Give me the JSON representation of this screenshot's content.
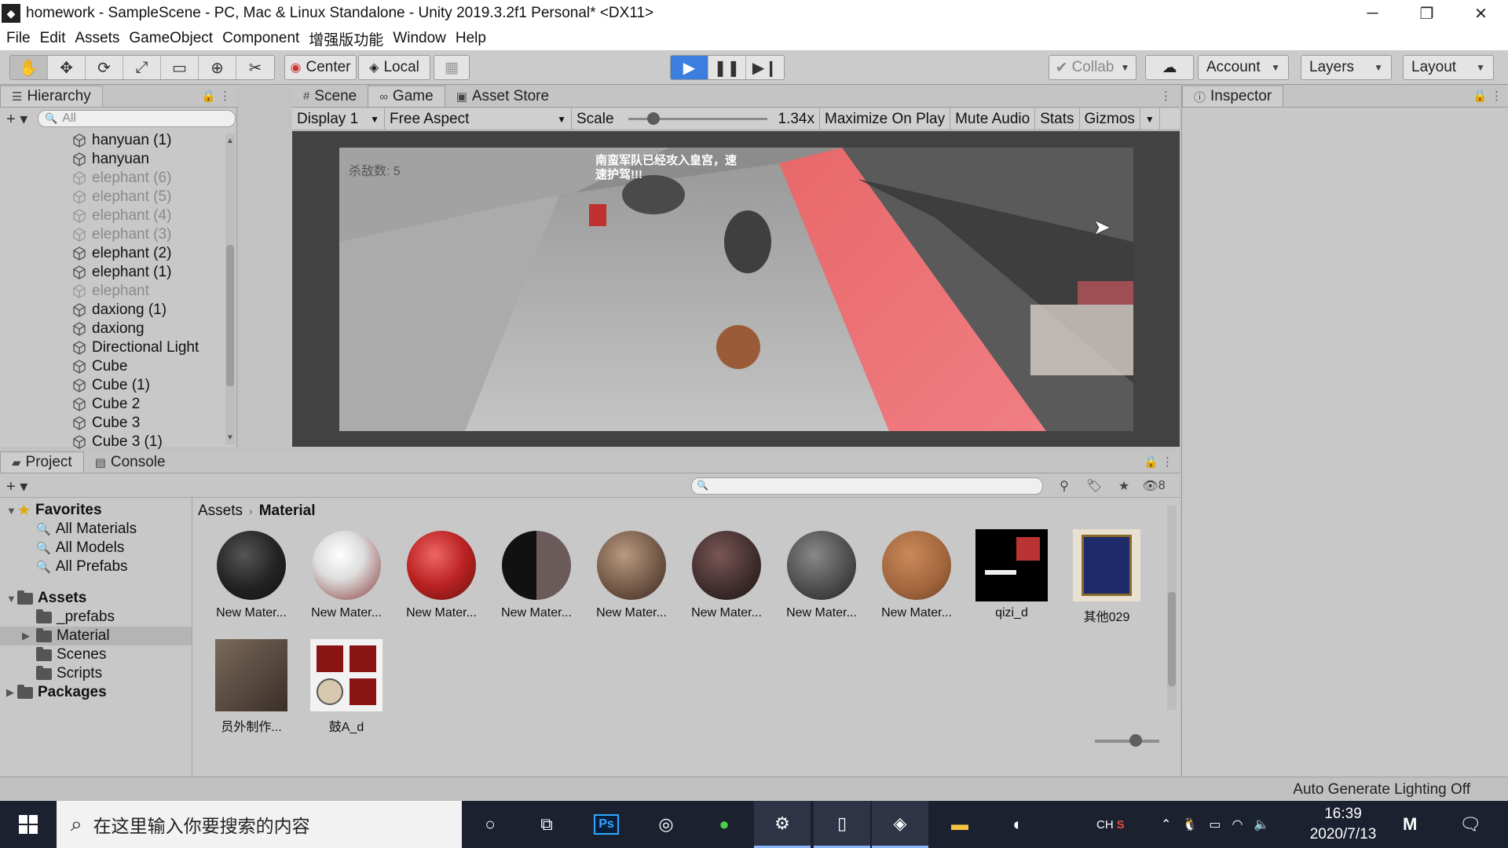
{
  "window": {
    "title": "homework - SampleScene - PC, Mac & Linux Standalone - Unity 2019.3.2f1 Personal* <DX11>",
    "minimize": "─",
    "restore": "❐",
    "close": "✕"
  },
  "menu": [
    "File",
    "Edit",
    "Assets",
    "GameObject",
    "Component",
    "增强版功能",
    "Window",
    "Help"
  ],
  "toolbar": {
    "pivot_label": "Center",
    "space_label": "Local",
    "collab_label": "Collab",
    "account_label": "Account",
    "layers_label": "Layers",
    "layout_label": "Layout"
  },
  "hierarchy": {
    "tab": "Hierarchy",
    "search_placeholder": "All",
    "items": [
      {
        "label": "hanyuan (1)",
        "dim": false
      },
      {
        "label": "hanyuan",
        "dim": false
      },
      {
        "label": "elephant (6)",
        "dim": true
      },
      {
        "label": "elephant (5)",
        "dim": true
      },
      {
        "label": "elephant (4)",
        "dim": true
      },
      {
        "label": "elephant (3)",
        "dim": true
      },
      {
        "label": "elephant (2)",
        "dim": false
      },
      {
        "label": "elephant (1)",
        "dim": false
      },
      {
        "label": "elephant",
        "dim": true
      },
      {
        "label": "daxiong (1)",
        "dim": false
      },
      {
        "label": "daxiong",
        "dim": false
      },
      {
        "label": "Directional Light",
        "dim": false
      },
      {
        "label": "Cube",
        "dim": false
      },
      {
        "label": "Cube (1)",
        "dim": false
      },
      {
        "label": "Cube 2",
        "dim": false
      },
      {
        "label": "Cube 3",
        "dim": false
      },
      {
        "label": "Cube 3 (1)",
        "dim": false
      }
    ]
  },
  "center_tabs": {
    "scene": "Scene",
    "game": "Game",
    "asset_store": "Asset Store"
  },
  "game_toolbar": {
    "display": "Display 1",
    "aspect": "Free Aspect",
    "scale_label": "Scale",
    "scale_value": "1.34x",
    "maximize": "Maximize On Play",
    "mute": "Mute Audio",
    "stats": "Stats",
    "gizmos": "Gizmos"
  },
  "game_view": {
    "kill_count": "杀敌数: 5",
    "alert": "南蛮军队已经攻入皇宫，速速护驾!!!"
  },
  "inspector": {
    "tab": "Inspector"
  },
  "project": {
    "tab_project": "Project",
    "tab_console": "Console",
    "hidden_count": "8",
    "favorites_label": "Favorites",
    "favorites": [
      "All Materials",
      "All Models",
      "All Prefabs"
    ],
    "assets_label": "Assets",
    "folders": [
      "_prefabs",
      "Material",
      "Scenes",
      "Scripts"
    ],
    "packages_label": "Packages",
    "breadcrumb": {
      "root": "Assets",
      "current": "Material"
    },
    "assets": [
      {
        "label": "New Mater...",
        "thumb": "dark-sphere"
      },
      {
        "label": "New Mater...",
        "thumb": "white-red-sphere"
      },
      {
        "label": "New Mater...",
        "thumb": "red-white-sphere"
      },
      {
        "label": "New Mater...",
        "thumb": "black-split-sphere"
      },
      {
        "label": "New Mater...",
        "thumb": "brown-sphere"
      },
      {
        "label": "New Mater...",
        "thumb": "dark-red-sphere"
      },
      {
        "label": "New Mater...",
        "thumb": "gray-tile-sphere"
      },
      {
        "label": "New Mater...",
        "thumb": "wood-sphere"
      },
      {
        "label": "qizi_d",
        "thumb": "flag-texture"
      },
      {
        "label": "其他029",
        "thumb": "plaque-texture"
      },
      {
        "label": "员外制作...",
        "thumb": "character-texture"
      },
      {
        "label": "鼓A_d",
        "thumb": "drum-texture"
      }
    ]
  },
  "status": {
    "lighting": "Auto Generate Lighting Off"
  },
  "taskbar": {
    "search_placeholder": "在这里输入你要搜索的内容",
    "ime": "CH",
    "time": "16:39",
    "date": "2020/7/13"
  },
  "colors": {
    "accent": "#3c7ee0",
    "panel_bg": "#c8c8c8",
    "taskbar_bg": "#1c2130"
  }
}
